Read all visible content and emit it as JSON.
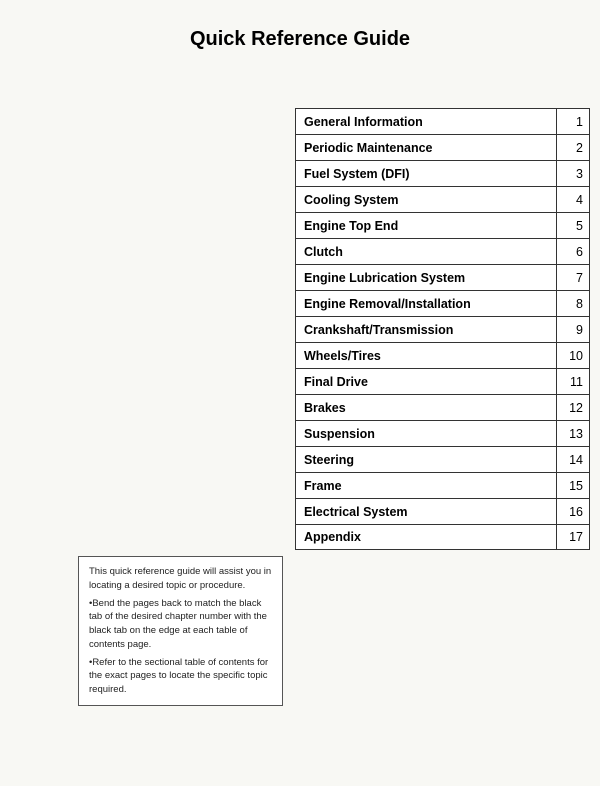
{
  "page": {
    "title": "Quick Reference Guide",
    "toc": {
      "items": [
        {
          "label": "General Information",
          "number": "1"
        },
        {
          "label": "Periodic Maintenance",
          "number": "2"
        },
        {
          "label": "Fuel System (DFI)",
          "number": "3"
        },
        {
          "label": "Cooling System",
          "number": "4"
        },
        {
          "label": "Engine Top End",
          "number": "5"
        },
        {
          "label": "Clutch",
          "number": "6"
        },
        {
          "label": "Engine Lubrication System",
          "number": "7"
        },
        {
          "label": "Engine Removal/Installation",
          "number": "8"
        },
        {
          "label": "Crankshaft/Transmission",
          "number": "9"
        },
        {
          "label": "Wheels/Tires",
          "number": "10"
        },
        {
          "label": "Final Drive",
          "number": "11"
        },
        {
          "label": "Brakes",
          "number": "12"
        },
        {
          "label": "Suspension",
          "number": "13"
        },
        {
          "label": "Steering",
          "number": "14"
        },
        {
          "label": "Frame",
          "number": "15"
        },
        {
          "label": "Electrical System",
          "number": "16"
        },
        {
          "label": "Appendix",
          "number": "17"
        }
      ]
    },
    "note": {
      "line1": "This quick reference guide will assist you in locating a desired topic or procedure.",
      "bullet1": "•Bend the pages back to match the black tab of the desired chapter number with the black tab on the edge at each table of contents page.",
      "bullet2": "•Refer to the sectional table of contents for the exact pages to locate the specific topic required."
    }
  }
}
